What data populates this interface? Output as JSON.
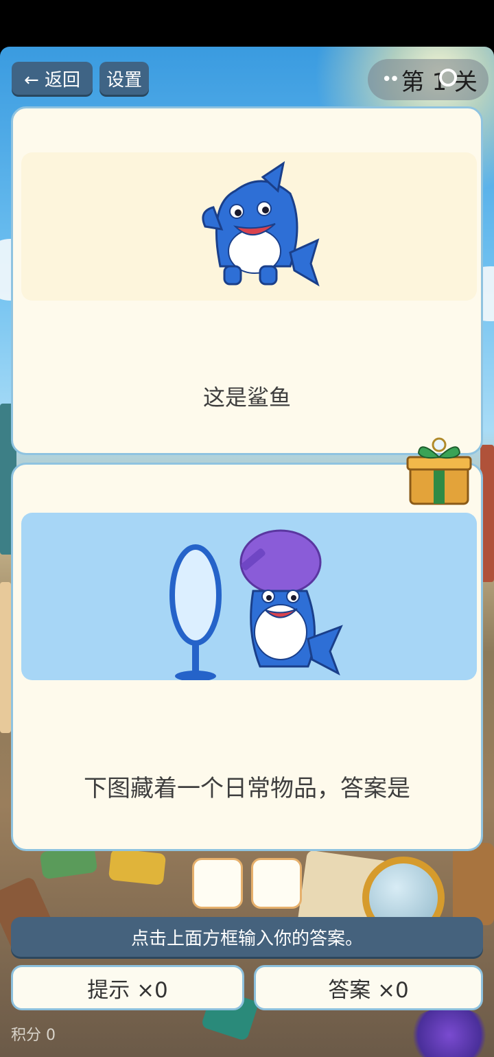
{
  "header": {
    "back_label": "← 返回",
    "settings_label": "设置",
    "level_dots": "••",
    "level_label": "第 1 关"
  },
  "example_card": {
    "caption": "这是鲨鱼"
  },
  "puzzle_card": {
    "caption": "下图藏着一个日常物品，答案是"
  },
  "answer": {
    "boxes": [
      "",
      ""
    ]
  },
  "instruction": "点击上面方框输入你的答案。",
  "actions": {
    "hint_label": "提示  ×0",
    "answer_label": "答案 ×0"
  },
  "score_label": "积分 0",
  "colors": {
    "card_bg": "#fefaec",
    "card_border": "#8fc3e0",
    "example_panel": "#fdf5dc",
    "puzzle_panel": "#a7d6f6",
    "shark_blue": "#2e6fd6",
    "button_bg": "#3f6485",
    "answer_box_border": "#e6b06c"
  },
  "icons": [
    "shark-icon",
    "mirror-icon",
    "comb-icon",
    "gift-icon",
    "settings-icon"
  ]
}
